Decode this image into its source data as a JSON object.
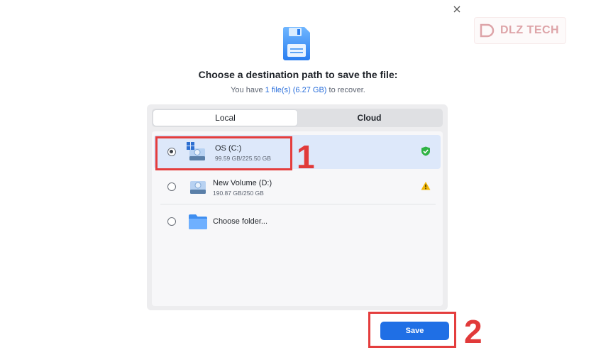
{
  "window": {
    "close_icon": "close-icon"
  },
  "watermark": {
    "text": "DLZ TECH"
  },
  "header": {
    "icon": "floppy-disk-icon",
    "title": "Choose a destination path to save the file:",
    "subtitle_prefix": "You have ",
    "file_count": "1 file(s)",
    "subtitle_mid": " ",
    "file_size": "(6.27 GB)",
    "subtitle_suffix": " to recover."
  },
  "tabs": {
    "local": "Local",
    "cloud": "Cloud",
    "active": "Local"
  },
  "destinations": [
    {
      "name": "OS (C:)",
      "size": "99.59 GB/225.50 GB",
      "icon": "windows-drive-icon",
      "status_icon": "shield-check-icon",
      "selected": true
    },
    {
      "name": "New Volume (D:)",
      "size": "190.87 GB/250 GB",
      "icon": "drive-icon",
      "status_icon": "warning-icon",
      "selected": false
    },
    {
      "name": "Choose folder...",
      "icon": "folder-icon",
      "selected": false
    }
  ],
  "annotations": {
    "step1": "1",
    "step2": "2"
  },
  "footer": {
    "save_label": "Save"
  },
  "colors": {
    "accent": "#1f6fe5",
    "selected_row": "#dde8fa",
    "annotation_red": "#e43d3d",
    "ok_green": "#2fb344",
    "warn_yellow": "#f2b705"
  }
}
